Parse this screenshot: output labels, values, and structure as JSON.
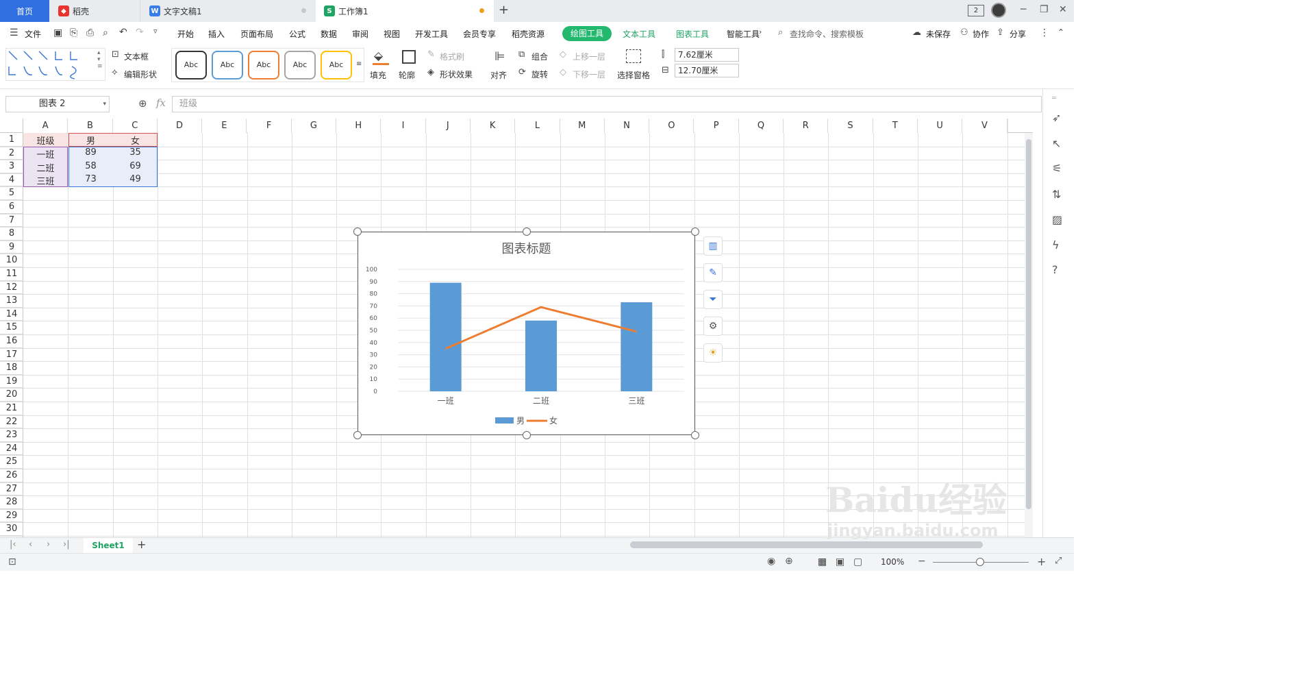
{
  "tabs": [
    {
      "label": "首页"
    },
    {
      "label": "稻壳",
      "icon": "docer-icon"
    },
    {
      "label": "文字文稿1",
      "icon": "writer-icon"
    },
    {
      "label": "工作簿1",
      "icon": "spreadsheet-icon",
      "active": true
    }
  ],
  "titlebar": {
    "count_badge": "2"
  },
  "menu": {
    "file": "文件",
    "items": [
      "开始",
      "插入",
      "页面布局",
      "公式",
      "数据",
      "审阅",
      "视图",
      "开发工具",
      "会员专享",
      "稻壳资源"
    ],
    "active_tool": "绘图工具",
    "context_tools": [
      "文本工具",
      "图表工具",
      "智能工具"
    ],
    "search_placeholder": "查找命令、搜索模板",
    "unsaved": "未保存",
    "collab": "协作",
    "share": "分享"
  },
  "ribbon": {
    "textbox": "文本框",
    "edit_shape": "编辑形状",
    "styles": [
      "Abc",
      "Abc",
      "Abc",
      "Abc",
      "Abc"
    ],
    "style_colors": [
      "#333333",
      "#5b9bd5",
      "#ed7d31",
      "#a5a5a5",
      "#ffc000"
    ],
    "fill": "填充",
    "outline": "轮廓",
    "format_painter": "格式刷",
    "shape_effects": "形状效果",
    "align": "对齐",
    "group": "组合",
    "rotate": "旋转",
    "bring_forward": "上移一层",
    "send_backward": "下移一层",
    "selection_pane": "选择窗格",
    "height": "7.62厘米",
    "width": "12.70厘米"
  },
  "formula_bar": {
    "name_box": "图表 2",
    "fx": "fx",
    "content": "班级"
  },
  "columns": [
    "A",
    "B",
    "C",
    "D",
    "E",
    "F",
    "G",
    "H",
    "I",
    "J",
    "K",
    "L",
    "M",
    "N",
    "O",
    "P",
    "Q",
    "R",
    "S",
    "T",
    "U",
    "V"
  ],
  "rows": [
    "1",
    "2",
    "3",
    "4",
    "5",
    "6",
    "7",
    "8",
    "9",
    "10",
    "11",
    "12",
    "13",
    "14",
    "15",
    "16",
    "17",
    "18",
    "19",
    "20",
    "21",
    "22",
    "23",
    "24",
    "25",
    "26",
    "27",
    "28",
    "29",
    "30"
  ],
  "cells": {
    "header": [
      "班级",
      "男",
      "女"
    ],
    "data": [
      [
        "一班",
        "89",
        "35"
      ],
      [
        "二班",
        "58",
        "69"
      ],
      [
        "三班",
        "73",
        "49"
      ]
    ]
  },
  "chart_data": {
    "type": "bar",
    "title": "图表标题",
    "categories": [
      "一班",
      "二班",
      "三班"
    ],
    "series": [
      {
        "name": "男",
        "type": "bar",
        "values": [
          89,
          58,
          73
        ],
        "color": "#5b9bd5"
      },
      {
        "name": "女",
        "type": "line",
        "values": [
          35,
          69,
          49
        ],
        "color": "#ed7d31"
      }
    ],
    "ylim": [
      0,
      100
    ],
    "yticks": [
      "100",
      "90",
      "80",
      "70",
      "60",
      "50",
      "40",
      "30",
      "20",
      "10",
      "0"
    ],
    "grid": true,
    "legend": "bottom"
  },
  "sheet": {
    "name": "Sheet1"
  },
  "status": {
    "zoom": "100%"
  },
  "watermark": {
    "brand": "Baidu经验",
    "url": "jingyan.baidu.com"
  }
}
